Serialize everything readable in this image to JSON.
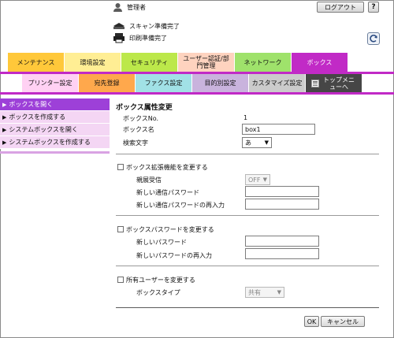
{
  "header": {
    "user_label": "管理者",
    "logout_label": "ログアウト",
    "help_label": "?",
    "status": [
      {
        "label": "スキャン準備完了",
        "icon": "scanner-icon"
      },
      {
        "label": "印刷準備完了",
        "icon": "printer-icon"
      }
    ]
  },
  "top_tabs": [
    {
      "label": "メンテナンス",
      "color": "#ffc83a"
    },
    {
      "label": "環境設定",
      "color": "#ffee94"
    },
    {
      "label": "セキュリティ",
      "color": "#bce84a"
    },
    {
      "label": "ユーザー認証/部門管理",
      "color": "#fed3bf"
    },
    {
      "label": "ネットワーク",
      "color": "#9fe26b"
    },
    {
      "label": "ボックス",
      "color": "#c12ac6",
      "active": true
    }
  ],
  "sub_tabs": [
    {
      "label": "プリンター設定",
      "color": "#ffd1f3"
    },
    {
      "label": "宛先登録",
      "color": "#ffa84c"
    },
    {
      "label": "ファクス設定",
      "color": "#a1e1e6"
    },
    {
      "label": "目的別設定",
      "color": "#c9b3dd"
    },
    {
      "label": "カスタマイズ設定",
      "color": "#cbcbcb"
    },
    {
      "label": "トップメニューへ",
      "color": "#464646"
    }
  ],
  "sidebar": {
    "items": [
      {
        "label": "ボックスを開く",
        "active": true
      },
      {
        "label": "ボックスを作成する",
        "active": false
      },
      {
        "label": "システムボックスを開く",
        "active": false
      },
      {
        "label": "システムボックスを作成する",
        "active": false
      }
    ]
  },
  "main": {
    "title": "ボックス属性変更",
    "box_no_label": "ボックスNo.",
    "box_no_value": "1",
    "box_name_label": "ボックス名",
    "box_name_value": "box1",
    "search_label": "検索文字",
    "search_value": "あ",
    "ext": {
      "checkbox_label": "ボックス拡張機能を変更する",
      "confidential_label": "親展受信",
      "confidential_value": "OFF",
      "new_pw_label": "新しい通信パスワード",
      "new_pw_confirm_label": "新しい通信パスワードの再入力"
    },
    "pw": {
      "checkbox_label": "ボックスパスワードを変更する",
      "new_pw_label": "新しいパスワード",
      "new_pw_confirm_label": "新しいパスワードの再入力"
    },
    "owner": {
      "checkbox_label": "所有ユーザーを変更する",
      "type_label": "ボックスタイプ",
      "type_value": "共有"
    },
    "ok_label": "OK",
    "cancel_label": "キャンセル"
  }
}
